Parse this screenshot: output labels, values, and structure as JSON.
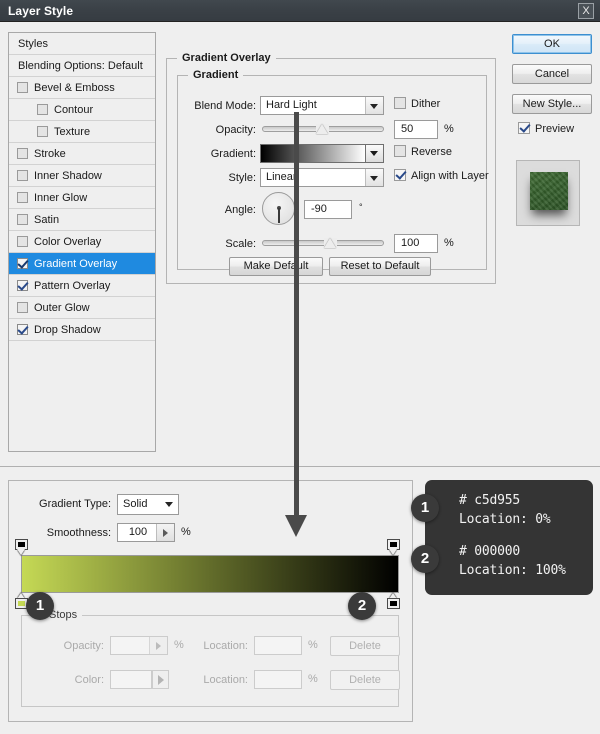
{
  "window": {
    "title": "Layer Style",
    "close_label": "X"
  },
  "styles_list": {
    "items": [
      {
        "label": "Styles",
        "type": "header",
        "checked": null,
        "selected": false,
        "indent": false
      },
      {
        "label": "Blending Options: Default",
        "type": "header",
        "checked": null,
        "selected": false,
        "indent": false
      },
      {
        "label": "Bevel & Emboss",
        "type": "item",
        "checked": false,
        "selected": false,
        "indent": false
      },
      {
        "label": "Contour",
        "type": "item",
        "checked": false,
        "selected": false,
        "indent": true
      },
      {
        "label": "Texture",
        "type": "item",
        "checked": false,
        "selected": false,
        "indent": true
      },
      {
        "label": "Stroke",
        "type": "item",
        "checked": false,
        "selected": false,
        "indent": false
      },
      {
        "label": "Inner Shadow",
        "type": "item",
        "checked": false,
        "selected": false,
        "indent": false
      },
      {
        "label": "Inner Glow",
        "type": "item",
        "checked": false,
        "selected": false,
        "indent": false
      },
      {
        "label": "Satin",
        "type": "item",
        "checked": false,
        "selected": false,
        "indent": false
      },
      {
        "label": "Color Overlay",
        "type": "item",
        "checked": false,
        "selected": false,
        "indent": false
      },
      {
        "label": "Gradient Overlay",
        "type": "item",
        "checked": true,
        "selected": true,
        "indent": false
      },
      {
        "label": "Pattern Overlay",
        "type": "item",
        "checked": true,
        "selected": false,
        "indent": false
      },
      {
        "label": "Outer Glow",
        "type": "item",
        "checked": false,
        "selected": false,
        "indent": false
      },
      {
        "label": "Drop Shadow",
        "type": "item",
        "checked": true,
        "selected": false,
        "indent": false
      }
    ]
  },
  "gradient_overlay": {
    "group_title": "Gradient Overlay",
    "subgroup_title": "Gradient",
    "blend_mode_label": "Blend Mode:",
    "blend_mode_value": "Hard Light",
    "dither_label": "Dither",
    "dither_checked": false,
    "opacity_label": "Opacity:",
    "opacity_value": "50",
    "opacity_unit": "%",
    "gradient_label": "Gradient:",
    "gradient_from": "#000000",
    "gradient_to": "#ffffff",
    "reverse_label": "Reverse",
    "reverse_checked": false,
    "style_label": "Style:",
    "style_value": "Linear",
    "align_label": "Align with Layer",
    "align_checked": true,
    "angle_label": "Angle:",
    "angle_value": "-90",
    "angle_unit": "°",
    "scale_label": "Scale:",
    "scale_value": "100",
    "scale_unit": "%",
    "make_default_label": "Make Default",
    "reset_default_label": "Reset to Default"
  },
  "right_buttons": {
    "ok": "OK",
    "cancel": "Cancel",
    "new_style": "New Style...",
    "preview_label": "Preview",
    "preview_checked": true
  },
  "gradient_editor": {
    "type_label": "Gradient Type:",
    "type_value": "Solid",
    "smoothness_label": "Smoothness:",
    "smoothness_value": "100",
    "smoothness_unit": "%",
    "bar_from": "#c5d955",
    "bar_to": "#000000",
    "stops_legend": "Stops",
    "opacity_label": "Opacity:",
    "opacity_value": "",
    "opacity_unit": "%",
    "color_label": "Color:",
    "location_label_1": "Location:",
    "location_value_1": "",
    "location_unit_1": "%",
    "location_label_2": "Location:",
    "location_value_2": "",
    "location_unit_2": "%",
    "delete_label_1": "Delete",
    "delete_label_2": "Delete"
  },
  "annotations": {
    "badge_1": "1",
    "badge_2": "2",
    "stop1_color": "# c5d955",
    "stop1_location": "Location: 0%",
    "stop2_color": "# 000000",
    "stop2_location": "Location: 100%"
  }
}
